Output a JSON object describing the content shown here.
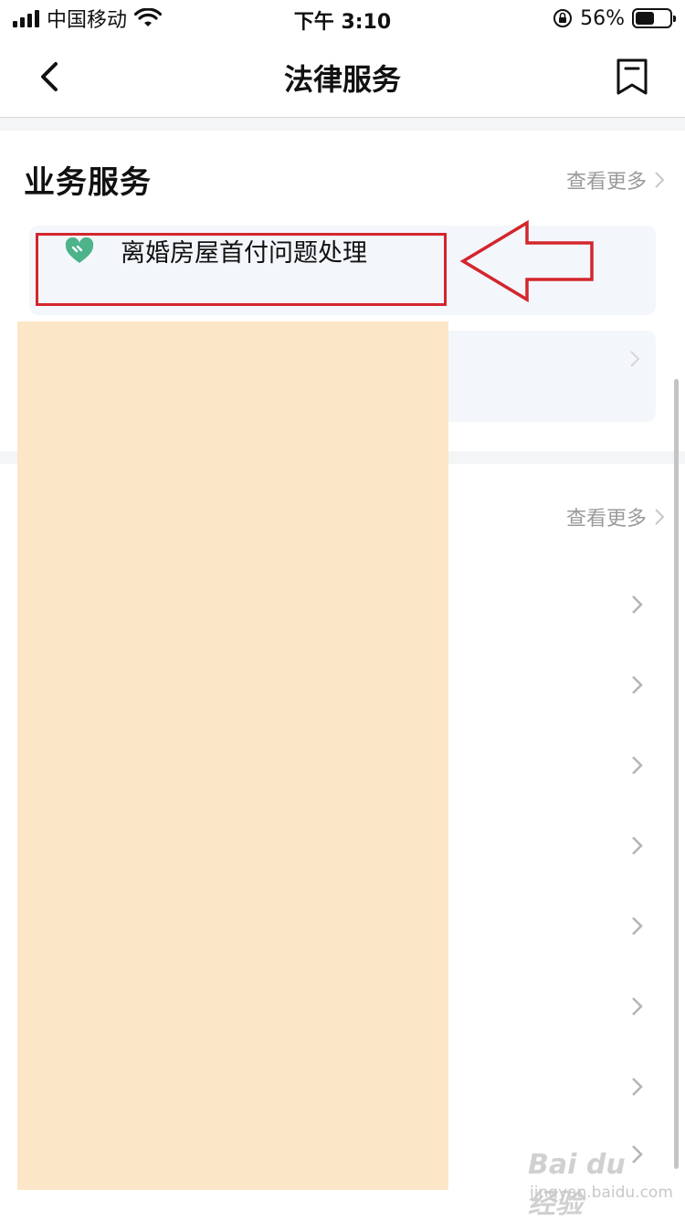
{
  "status_bar": {
    "carrier": "中国移动",
    "time": "下午 3:10",
    "battery_percent": "56%",
    "battery_level": 0.56
  },
  "navbar": {
    "title": "法律服务",
    "back_icon": "chevron-left-icon",
    "bookmark_icon": "bookmark-icon"
  },
  "section_business": {
    "title": "业务服务",
    "more_label": "查看更多",
    "items": [
      {
        "label": "离婚房屋首付问题处理",
        "icon": "heart-icon",
        "icon_color": "#4cb38a"
      }
    ]
  },
  "section_two": {
    "more_label": "查看更多"
  },
  "annotation": {
    "highlight_color": "#d3262d"
  },
  "watermark": {
    "main": "Bai du 经验",
    "sub": "jingyan.baidu.com"
  }
}
